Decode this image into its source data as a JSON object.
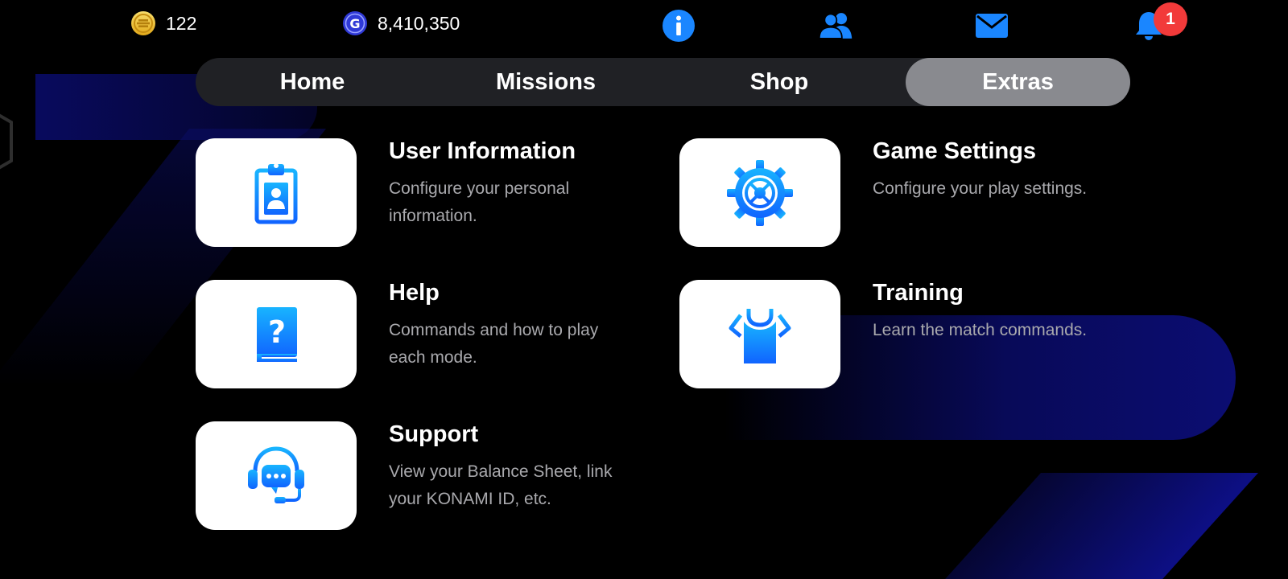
{
  "currencies": {
    "coins": "122",
    "gp": "8,410,350"
  },
  "top_icons": [
    "info-icon",
    "friends-icon",
    "mail-icon",
    "bell-icon"
  ],
  "notification_count": "1",
  "tabs": {
    "home": "Home",
    "missions": "Missions",
    "shop": "Shop",
    "extras": "Extras",
    "active": "Extras"
  },
  "menu": {
    "user_information": {
      "title": "User Information",
      "description": "Configure your personal information.",
      "icon": "id-badge-icon"
    },
    "game_settings": {
      "title": "Game Settings",
      "description": "Configure your play settings.",
      "icon": "gear-icon"
    },
    "help": {
      "title": "Help",
      "description": "Commands and how to play each mode.",
      "icon": "help-book-icon"
    },
    "training": {
      "title": "Training",
      "description": "Learn the match commands.",
      "icon": "training-shirt-icon"
    },
    "support": {
      "title": "Support",
      "description": "View your Balance Sheet, link your KONAMI ID, etc.",
      "icon": "support-headset-icon"
    }
  },
  "colors": {
    "accent_blue": "#1a86ff",
    "active_tab": "#898a8f",
    "tabbar_bg": "#202125",
    "badge_red": "#f23a3a",
    "coin_gold": "#f2c230",
    "gp_blue": "#2f39d6"
  }
}
